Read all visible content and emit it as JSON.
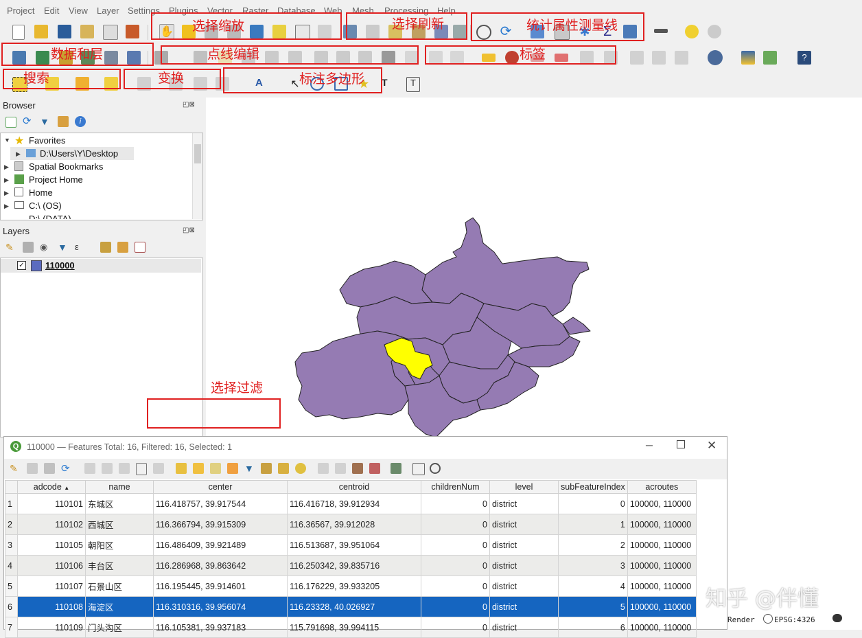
{
  "menu": [
    "Project",
    "Edit",
    "View",
    "Layer",
    "Settings",
    "Plugins",
    "Vector",
    "Raster",
    "Database",
    "Web",
    "Mesh",
    "Processing",
    "Help"
  ],
  "annotations": {
    "select_zoom": "选择缩放",
    "select_refresh": "选择刷新",
    "stats_measure": "统计属性测量线",
    "data_layers": "数据和层",
    "point_line_edit": "点线编辑",
    "labels": "标签",
    "search": "搜索",
    "transform": "变换",
    "label_polygon": "标注多边形",
    "select_filter": "选择过滤"
  },
  "browser": {
    "title": "Browser",
    "items": [
      {
        "label": "Favorites",
        "icon": "star-icon"
      },
      {
        "label": "D:\\Users\\Y\\Desktop",
        "icon": "folder-icon"
      },
      {
        "label": "Spatial Bookmarks",
        "icon": "bookmark-icon"
      },
      {
        "label": "Project Home",
        "icon": "project-home-icon"
      },
      {
        "label": "Home",
        "icon": "home-icon"
      },
      {
        "label": "C:\\ (OS)",
        "icon": "drive-icon"
      },
      {
        "label": "D:\\ (DATA)",
        "icon": "drive-icon"
      }
    ]
  },
  "layers": {
    "title": "Layers",
    "items": [
      {
        "label": "110000",
        "checked": true,
        "color": "#5b6bbf"
      }
    ]
  },
  "map": {
    "fill_color": "#957bb3",
    "selected_color": "#ffff00"
  },
  "attribute_table": {
    "title": "110000 — Features Total: 16, Filtered: 16, Selected: 1",
    "columns": [
      "adcode",
      "name",
      "center",
      "centroid",
      "childrenNum",
      "level",
      "subFeatureIndex",
      "acroutes"
    ],
    "rows": [
      {
        "num": "1",
        "adcode": "110101",
        "name": "东城区",
        "center": "116.418757, 39.917544",
        "centroid": "116.416718, 39.912934",
        "childrenNum": "0",
        "level": "district",
        "subFeatureIndex": "0",
        "acroutes": "100000, 110000"
      },
      {
        "num": "2",
        "adcode": "110102",
        "name": "西城区",
        "center": "116.366794, 39.915309",
        "centroid": "116.36567, 39.912028",
        "childrenNum": "0",
        "level": "district",
        "subFeatureIndex": "1",
        "acroutes": "100000, 110000"
      },
      {
        "num": "3",
        "adcode": "110105",
        "name": "朝阳区",
        "center": "116.486409, 39.921489",
        "centroid": "116.513687, 39.951064",
        "childrenNum": "0",
        "level": "district",
        "subFeatureIndex": "2",
        "acroutes": "100000, 110000"
      },
      {
        "num": "4",
        "adcode": "110106",
        "name": "丰台区",
        "center": "116.286968, 39.863642",
        "centroid": "116.250342, 39.835716",
        "childrenNum": "0",
        "level": "district",
        "subFeatureIndex": "3",
        "acroutes": "100000, 110000"
      },
      {
        "num": "5",
        "adcode": "110107",
        "name": "石景山区",
        "center": "116.195445, 39.914601",
        "centroid": "116.176229, 39.933205",
        "childrenNum": "0",
        "level": "district",
        "subFeatureIndex": "4",
        "acroutes": "100000, 110000"
      },
      {
        "num": "6",
        "adcode": "110108",
        "name": "海淀区",
        "center": "116.310316, 39.956074",
        "centroid": "116.23328, 40.026927",
        "childrenNum": "0",
        "level": "district",
        "subFeatureIndex": "5",
        "acroutes": "100000, 110000"
      },
      {
        "num": "7",
        "adcode": "110109",
        "name": "门头沟区",
        "center": "116.105381, 39.937183",
        "centroid": "115.791698, 39.994115",
        "childrenNum": "0",
        "level": "district",
        "subFeatureIndex": "6",
        "acroutes": "100000, 110000"
      }
    ]
  },
  "statusbar": {
    "render": "Render",
    "crs": "EPSG:4326"
  },
  "watermark": "知乎 @伴懂"
}
